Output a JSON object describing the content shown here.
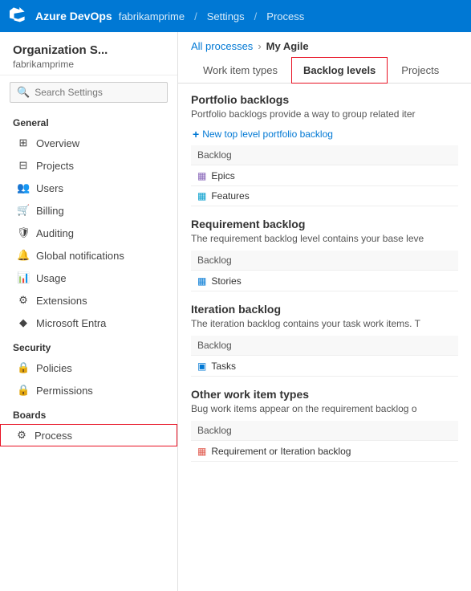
{
  "topNav": {
    "brand": "Azure DevOps",
    "org": "fabrikamprime",
    "sep1": "/",
    "settings": "Settings",
    "sep2": "/",
    "process": "Process"
  },
  "sidebar": {
    "orgName": "Organization S...",
    "orgSub": "fabrikamprime",
    "searchPlaceholder": "Search Settings",
    "sections": [
      {
        "title": "General",
        "items": [
          {
            "label": "Overview",
            "icon": "⊞"
          },
          {
            "label": "Projects",
            "icon": "⊟"
          },
          {
            "label": "Users",
            "icon": "👥"
          },
          {
            "label": "Billing",
            "icon": "🛒"
          },
          {
            "label": "Auditing",
            "icon": "🛡"
          },
          {
            "label": "Global notifications",
            "icon": "🔔"
          },
          {
            "label": "Usage",
            "icon": "📊"
          },
          {
            "label": "Extensions",
            "icon": "⚙"
          },
          {
            "label": "Microsoft Entra",
            "icon": "◆"
          }
        ]
      },
      {
        "title": "Security",
        "items": [
          {
            "label": "Policies",
            "icon": "🔒"
          },
          {
            "label": "Permissions",
            "icon": "🔒"
          }
        ]
      },
      {
        "title": "Boards",
        "items": [
          {
            "label": "Process",
            "icon": "⚙",
            "selected": true
          }
        ]
      }
    ]
  },
  "breadcrumb": {
    "parent": "All processes",
    "arrow": "›",
    "current": "My Agile"
  },
  "tabs": [
    {
      "label": "Work item types",
      "active": false
    },
    {
      "label": "Backlog levels",
      "active": true
    },
    {
      "label": "Projects",
      "active": false
    }
  ],
  "portfolioBacklogs": {
    "title": "Portfolio backlogs",
    "desc": "Portfolio backlogs provide a way to group related iter",
    "addLabel": "New top level portfolio backlog",
    "backlogLabel": "Backlog",
    "items": [
      {
        "label": "Epics",
        "icon": "▦",
        "iconClass": "item-icon-purple"
      },
      {
        "label": "Features",
        "icon": "▦",
        "iconClass": "item-icon-teal"
      }
    ]
  },
  "requirementBacklog": {
    "title": "Requirement backlog",
    "desc": "The requirement backlog level contains your base leve",
    "backlogLabel": "Backlog",
    "items": [
      {
        "label": "Stories",
        "icon": "▦",
        "iconClass": "item-icon-blue"
      }
    ]
  },
  "iterationBacklog": {
    "title": "Iteration backlog",
    "desc": "The iteration backlog contains your task work items. T",
    "backlogLabel": "Backlog",
    "items": [
      {
        "label": "Tasks",
        "icon": "▣",
        "iconClass": "item-icon-blue"
      }
    ]
  },
  "otherWorkItemTypes": {
    "title": "Other work item types",
    "desc": "Bug work items appear on the requirement backlog o",
    "backlogLabel": "Backlog",
    "items": [
      {
        "label": "Requirement or Iteration backlog",
        "icon": "▦",
        "iconClass": "item-icon-red"
      }
    ]
  }
}
